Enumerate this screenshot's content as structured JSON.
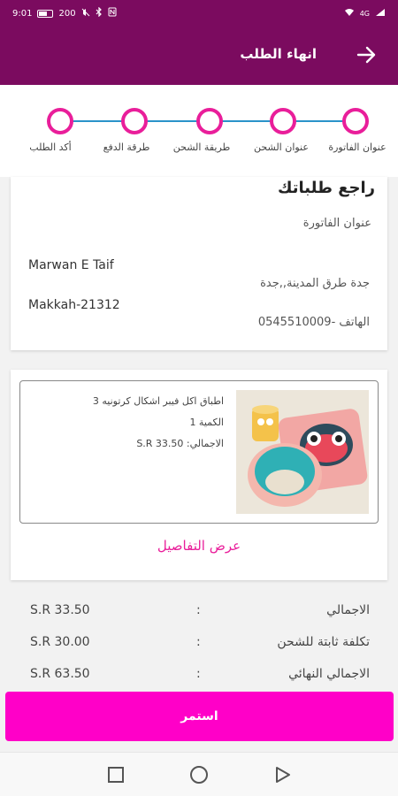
{
  "status_bar": {
    "time": "9:01",
    "data_speed": "200",
    "network_label": "4G"
  },
  "app_bar": {
    "title": "انهاء الطلب",
    "back_icon": "arrow-right-icon"
  },
  "stepper": {
    "steps": [
      {
        "label": "عنوان الفاتورة"
      },
      {
        "label": "عنوان الشحن"
      },
      {
        "label": "طريقة الشحن"
      },
      {
        "label": "طرقة الدفع"
      },
      {
        "label": "أكد الطلب"
      }
    ],
    "accent_color": "#e91e9a",
    "line_color": "#2a93c9"
  },
  "address": {
    "heading": "راجع طلباتك",
    "subheading": "عنوان الفاتورة",
    "name": "Marwan E Taif",
    "city": "Makkah-21312",
    "street": "جدة طرق المدينة,,جدة",
    "phone": "الهاتف -0545510009"
  },
  "product": {
    "name": "اطباق اكل فيبر اشكال كرتونيه 3",
    "quantity": "الكمية 1",
    "total": "الاجمالي: S.R 33.50",
    "details_link": "عرض التفاصيل"
  },
  "summary": [
    {
      "label": "الاجمالي",
      "colon": ":",
      "value": "S.R 33.50"
    },
    {
      "label": "تكلفة ثابتة للشحن",
      "colon": ":",
      "value": "S.R 30.00"
    },
    {
      "label": "الاجمالي النهائي",
      "colon": ":",
      "value": "S.R 63.50"
    }
  ],
  "continue_button": {
    "label": "استمر",
    "color": "#ff00c8"
  },
  "nav_bar": {
    "icons": [
      "recent-apps-icon",
      "home-icon",
      "back-icon"
    ]
  },
  "colors": {
    "brand": "#7b0b5f"
  }
}
